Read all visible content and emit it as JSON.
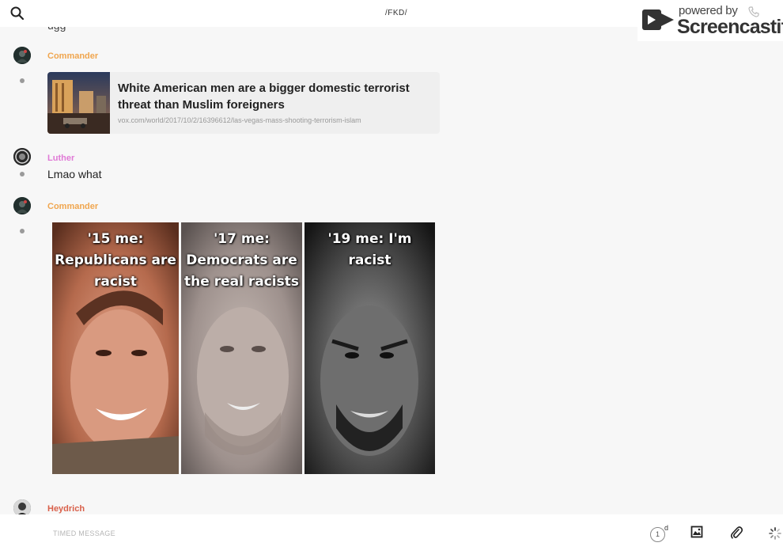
{
  "header": {
    "channel_title": "/FKD/",
    "watermark": {
      "powered_text": "powered by",
      "brand_text": "Screencastify"
    }
  },
  "colors": {
    "commander": "#f0a64f",
    "luther": "#e07ad6",
    "heydrich": "#d9604a"
  },
  "messages": {
    "partial_top_text": "ugg",
    "m1": {
      "author": "Commander",
      "link": {
        "title": "White American men are a bigger domestic terrorist threat than Muslim foreigners",
        "url": "vox.com/world/2017/10/2/16396612/las-vegas-mass-shooting-terrorism-islam"
      }
    },
    "m2": {
      "author": "Luther",
      "text": "Lmao what"
    },
    "m3": {
      "author": "Commander",
      "meme_panels": [
        {
          "caption": "'15 me:\nRepublicans are\nracist"
        },
        {
          "caption": "'17 me:\nDemocrats are\nthe real racists"
        },
        {
          "caption": "'19 me: I'm\nracist"
        }
      ]
    },
    "m4": {
      "author": "Heydrich"
    }
  },
  "composer": {
    "placeholder": "TIMED MESSAGE",
    "timer_value": "1",
    "timer_unit": "d",
    "icons": [
      "timer-icon",
      "image-icon",
      "paperclip-icon",
      "loading-spinner-icon"
    ]
  }
}
